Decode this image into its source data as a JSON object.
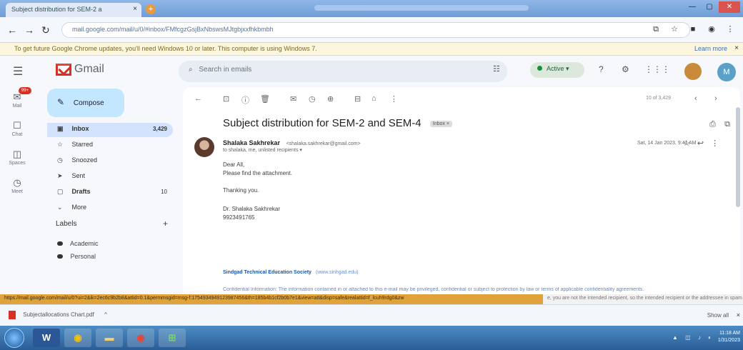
{
  "browser": {
    "tab_title": "Subject distribution for SEM-2 a",
    "tab_close": "×",
    "new_tab": "+",
    "url": "mail.google.com/mail/u/0/#inbox/FMfcgzGsjBxNbswsMJtgbjxxfhkbmbh",
    "info_message": "To get future Google Chrome updates, you'll need Windows 10 or later. This computer is using Windows 7.",
    "learn_more": "Learn more",
    "info_close": "×"
  },
  "gmail": {
    "logo_text": "Gmail",
    "search_placeholder": "Search in emails",
    "active_status": "Active",
    "avatar_initial": "M",
    "compose": "Compose",
    "rail": [
      {
        "icon": "✉",
        "label": "Mail",
        "badge": "99+"
      },
      {
        "icon": "☐",
        "label": "Chat"
      },
      {
        "icon": "◫",
        "label": "Spaces"
      },
      {
        "icon": "◷",
        "label": "Meet"
      }
    ],
    "folders": [
      {
        "icon": "▣",
        "label": "Inbox",
        "count": "3,429"
      },
      {
        "icon": "☆",
        "label": "Starred",
        "count": ""
      },
      {
        "icon": "◷",
        "label": "Snoozed",
        "count": ""
      },
      {
        "icon": "➤",
        "label": "Sent",
        "count": ""
      },
      {
        "icon": "▢",
        "label": "Drafts",
        "count": "10"
      },
      {
        "icon": "⌄",
        "label": "More",
        "count": ""
      }
    ],
    "labels_heading": "Labels",
    "labels_add": "+",
    "labels": [
      "Academic",
      "Personal"
    ]
  },
  "email": {
    "pager": "10 of 3,429",
    "subject": "Subject distribution for SEM-2 and SEM-4",
    "inbox_tag": "Inbox ×",
    "sender_name": "Shalaka Sakhrekar",
    "sender_email": "<shalaka.sakhrekar@gmail.com>",
    "to": "to shalaka, me, unlisted recipients ▾",
    "date": "Sat, 14 Jan 2023, 9:41 AM",
    "body": [
      "Dear All,",
      "Please find the attachment.",
      "Thanking you.",
      "Dr. Shalaka Sakhrekar",
      "9923491765"
    ],
    "footer_org": "Sindgad Technical Education Society",
    "footer_org_link": "(www.sinhgad.edu)",
    "footer_disclaimer": "Confidential Information: The information contained in or attached to this e-mail may be privileged, confidential or subject to protection by law or terms of applicable confidentiality agreements."
  },
  "status": {
    "url": "https://mail.google.com/mail/u/0?ui=2&ik=2ec6c9b2b8&attid=0.1&permmsgid=msg-f:1754934949123987456&th=185b4b1cf2b0b7e1&view=att&disp=safe&realattid=f_lcuh9rdg0&zw",
    "tail": "e, you are not the intended recipient, so the intended recipient or the addressee in spam"
  },
  "shelf": {
    "item": "Subjectallocations Chart.pdf",
    "caret": "^",
    "show_all": "Show all",
    "close": "×"
  },
  "taskbar": {
    "apps": [
      "W",
      "◉",
      "▬",
      "◉",
      "⊞"
    ],
    "tray": "▲ ◫ ♪ ◐",
    "time": "11:18 AM",
    "date": "1/31/2023"
  },
  "colors": {
    "accent": "#1a73e8",
    "compose_bg": "#c2e7ff",
    "selected_folder": "#d3e3fd",
    "status_url_bg": "#e0a23b"
  }
}
